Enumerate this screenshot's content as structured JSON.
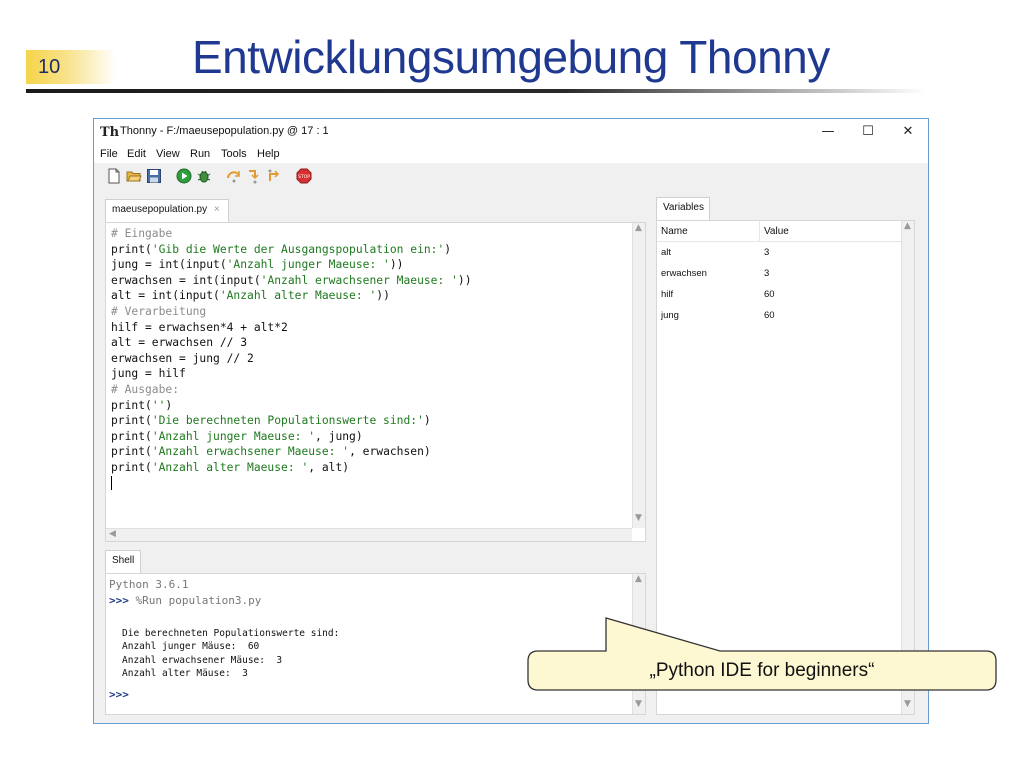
{
  "slide": {
    "number": "10",
    "title": "Entwicklungsumgebung Thonny"
  },
  "window": {
    "title": "Thonny  -  F:/maeusepopulation.py  @  17 : 1",
    "app_icon": "Th",
    "minimize": "—",
    "maximize": "☐",
    "close": "✕"
  },
  "menu": [
    "File",
    "Edit",
    "View",
    "Run",
    "Tools",
    "Help"
  ],
  "toolbar": {
    "icons": [
      "new-file-icon",
      "open-folder-icon",
      "save-icon",
      "run-icon",
      "debug-icon",
      "step-over-icon",
      "step-into-icon",
      "step-out-icon",
      "stop-icon"
    ],
    "stop_label": "STOP"
  },
  "editor": {
    "tab_label": "maeusepopulation.py",
    "tab_close": "×",
    "lines": [
      {
        "kind": "comment",
        "text": "# Eingabe"
      },
      {
        "kind": "code",
        "parts": [
          "print(",
          "'Gib die Werte der Ausgangspopulation ein:'",
          ")"
        ]
      },
      {
        "kind": "code",
        "parts": [
          "jung = int(input(",
          "'Anzahl junger Maeuse: '",
          "))"
        ]
      },
      {
        "kind": "code",
        "parts": [
          "erwachsen = int(input(",
          "'Anzahl erwachsener Maeuse: '",
          "))"
        ]
      },
      {
        "kind": "code",
        "parts": [
          "alt = int(input(",
          "'Anzahl alter Maeuse: '",
          "))"
        ]
      },
      {
        "kind": "comment",
        "text": "# Verarbeitung"
      },
      {
        "kind": "plain",
        "text": "hilf = erwachsen*4 + alt*2"
      },
      {
        "kind": "plain",
        "text": "alt = erwachsen // 3"
      },
      {
        "kind": "plain",
        "text": "erwachsen = jung // 2"
      },
      {
        "kind": "plain",
        "text": "jung = hilf"
      },
      {
        "kind": "comment",
        "text": "# Ausgabe:"
      },
      {
        "kind": "code",
        "parts": [
          "print(",
          "''",
          ")"
        ]
      },
      {
        "kind": "code",
        "parts": [
          "print(",
          "'Die berechneten Populationswerte sind:'",
          ")"
        ]
      },
      {
        "kind": "code",
        "parts": [
          "print(",
          "'Anzahl junger Maeuse: '",
          ", jung)"
        ]
      },
      {
        "kind": "code",
        "parts": [
          "print(",
          "'Anzahl erwachsener Maeuse: '",
          ", erwachsen)"
        ]
      },
      {
        "kind": "code",
        "parts": [
          "print(",
          "'Anzahl alter Maeuse: '",
          ", alt)"
        ]
      }
    ]
  },
  "shell": {
    "tab_label": "Shell",
    "version": "Python 3.6.1",
    "prompt": ">>>",
    "command": " %Run population3.py",
    "output": [
      "Die berechneten Populationswerte sind:",
      "Anzahl junger Mäuse:  60",
      "Anzahl erwachsener Mäuse:  3",
      "Anzahl alter Mäuse:  3"
    ],
    "final_prompt": ">>>"
  },
  "variables": {
    "tab_label": "Variables",
    "col_name": "Name",
    "col_value": "Value",
    "rows": [
      {
        "name": "alt",
        "value": "3"
      },
      {
        "name": "erwachsen",
        "value": "3"
      },
      {
        "name": "hilf",
        "value": "60"
      },
      {
        "name": "jung",
        "value": "60"
      }
    ]
  },
  "callout": {
    "text": "„Python IDE for beginners“"
  },
  "colors": {
    "title_blue": "#1f3890",
    "slide_number_gold": "#f6d44a",
    "code_string_green": "#1f7a1f",
    "code_comment_gray": "#8c8c8c",
    "callout_fill": "#fdf8d2",
    "window_border": "#6b9fd4"
  }
}
